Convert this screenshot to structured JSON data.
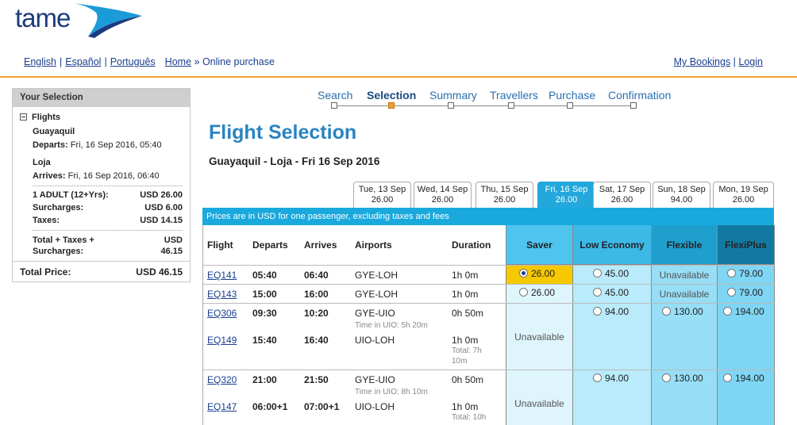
{
  "logo": {
    "text": "tame"
  },
  "top_nav": {
    "languages": [
      "English",
      "Español",
      "Português"
    ],
    "home": "Home",
    "crumb_sep": "»",
    "current": "Online purchase",
    "my_bookings": "My Bookings",
    "login": "Login"
  },
  "selection_box": {
    "title": "Your Selection",
    "flights_label": "Flights",
    "origin": "Guayaquil",
    "departs_label": "Departs:",
    "departs_value": "Fri, 16 Sep 2016, 05:40",
    "destination": "Loja",
    "arrives_label": "Arrives:",
    "arrives_value": "Fri, 16 Sep 2016, 06:40",
    "adult_label": "1 ADULT (12+Yrs):",
    "adult_value": "USD 26.00",
    "surcharges_label": "Surcharges:",
    "surcharges_value": "USD 6.00",
    "taxes_label": "Taxes:",
    "taxes_value": "USD 14.15",
    "sum_label_1": "Total + Taxes +",
    "sum_label_2": "Surcharges:",
    "sum_value_1": "USD",
    "sum_value_2": "46.15",
    "total_label": "Total Price:",
    "total_value": "USD 46.15"
  },
  "steps": [
    {
      "label": "Search",
      "active": false
    },
    {
      "label": "Selection",
      "active": true
    },
    {
      "label": "Summary",
      "active": false
    },
    {
      "label": "Travellers",
      "active": false
    },
    {
      "label": "Purchase",
      "active": false
    },
    {
      "label": "Confirmation",
      "active": false
    }
  ],
  "page_title": "Flight Selection",
  "route_title": "Guayaquil - Loja - Fri 16 Sep 2016",
  "date_tabs": [
    {
      "date": "Tue, 13 Sep",
      "price": "26.00"
    },
    {
      "date": "Wed, 14 Sep",
      "price": "26.00"
    },
    {
      "date": "Thu, 15 Sep",
      "price": "26.00"
    },
    {
      "date": "Fri, 16 Sep",
      "price": "26.00",
      "active": true
    },
    {
      "date": "Sat, 17 Sep",
      "price": "26.00"
    },
    {
      "date": "Sun, 18 Sep",
      "price": "94.00"
    },
    {
      "date": "Mon, 19 Sep",
      "price": "26.00"
    }
  ],
  "price_note": "Prices are in USD for one passenger, excluding taxes and fees",
  "table": {
    "headers": {
      "flight": "Flight",
      "departs": "Departs",
      "arrives": "Arrives",
      "airports": "Airports",
      "duration": "Duration",
      "saver": "Saver",
      "low": "Low Economy",
      "flexible": "Flexible",
      "flexiplus": "FlexiPlus"
    },
    "unavailable": "Unavailable",
    "rows": [
      {
        "flight": "EQ141",
        "dep": "05:40",
        "arr": "06:40",
        "airports": "GYE-LOH",
        "dur": "1h 0m",
        "saver": "26.00",
        "low": "45.00",
        "flex": "Unavailable",
        "fp": "79.00"
      },
      {
        "flight": "EQ143",
        "dep": "15:00",
        "arr": "16:00",
        "airports": "GYE-LOH",
        "dur": "1h 0m",
        "saver": "26.00",
        "low": "45.00",
        "flex": "Unavailable",
        "fp": "79.00"
      },
      {
        "flight": "EQ306",
        "dep": "09:30",
        "arr": "10:20",
        "airports": "GYE-UIO",
        "layover": "Time in UIO: 5h 20m",
        "dur": "0h 50m",
        "low": "94.00",
        "flex": "130.00",
        "fp": "194.00",
        "leg2": {
          "flight": "EQ149",
          "dep": "15:40",
          "arr": "16:40",
          "airports": "UIO-LOH",
          "dur": "1h 0m",
          "total1": "Total: 7h",
          "total2": "10m"
        }
      },
      {
        "flight": "EQ320",
        "dep": "21:00",
        "arr": "21:50",
        "airports": "GYE-UIO",
        "layover": "Time in UIO: 8h 10m",
        "dur": "0h 50m",
        "low": "94.00",
        "flex": "130.00",
        "fp": "194.00",
        "leg2": {
          "flight": "EQ147",
          "dep": "06:00+1",
          "arr": "07:00+1",
          "airports": "UIO-LOH",
          "dur": "1h 0m",
          "total1": "Total: 10h"
        }
      }
    ]
  },
  "colors": {
    "accent": "#2a84c0",
    "bar": "#1aa9dd",
    "orange": "#f0a030",
    "selected": "#f5c800"
  }
}
